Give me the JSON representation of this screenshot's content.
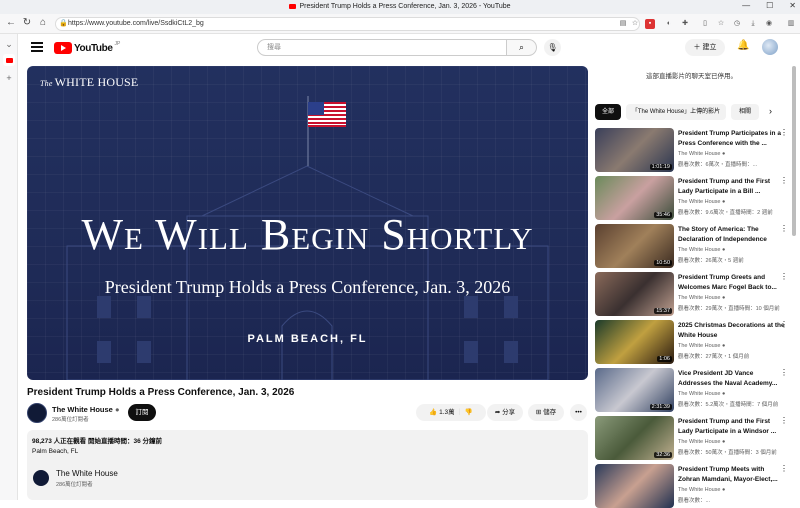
{
  "browser": {
    "tab_title": "President Trump Holds a Press Conference, Jan. 3, 2026 - YouTube",
    "url": "https://www.youtube.com/live/SsdkiCtL2_bg"
  },
  "youtube": {
    "logo_text": "YouTube",
    "logo_region": "JP",
    "search_placeholder": "搜尋",
    "create_label": "建立"
  },
  "player": {
    "logo_prefix": "The",
    "logo_text": "WHITE HOUSE",
    "headline": "We Will Begin Shortly",
    "subheadline": "President Trump Holds a Press Conference, Jan. 3, 2026",
    "location": "PALM BEACH, FL"
  },
  "video": {
    "title": "President Trump Holds a Press Conference, Jan. 3, 2026",
    "channel_name": "The White House",
    "channel_subs": "286萬位訂閱者",
    "subscribe_label": "訂閱",
    "likes": "1.3萬",
    "share_label": "分享",
    "save_label": "儲存",
    "more_label": "•••"
  },
  "description": {
    "line1": "98,273 人正在觀看  開始直播時間：36 分鐘前",
    "line2": "Palm Beach, FL",
    "channel_name": "The White House",
    "channel_subs": "286萬位訂閱者"
  },
  "chat": {
    "notice": "這部直播影片的聊天室已停用。"
  },
  "chips": [
    "全部",
    "「The White House」上傳的影片",
    "相關"
  ],
  "recommendations": [
    {
      "title": "President Trump Participates in a Press Conference with the ...",
      "channel": "The White House",
      "meta": "觀看次數：6萬次・直播時間：...",
      "duration": "1:01:19"
    },
    {
      "title": "President Trump and the First Lady Participate in a Bill ...",
      "channel": "The White House",
      "meta": "觀看次數：9.6萬次・直播時間：2 週前",
      "duration": "35:46"
    },
    {
      "title": "The Story of America: The Declaration of Independence",
      "channel": "The White House",
      "meta": "觀看次數：26萬次・5 週前",
      "duration": "10:50"
    },
    {
      "title": "President Trump Greets and Welcomes Marc Fogel Back to...",
      "channel": "The White House",
      "meta": "觀看次數：29萬次・直播時間：10 個月前",
      "duration": "15:37"
    },
    {
      "title": "2025 Christmas Decorations at the White House",
      "channel": "The White House",
      "meta": "觀看次數：27萬次・1 個月前",
      "duration": "1:06"
    },
    {
      "title": "Vice President JD Vance Addresses the Naval Academy...",
      "channel": "The White House",
      "meta": "觀看次數：5.2萬次・直播時間：7 個月前",
      "duration": "2:31:39"
    },
    {
      "title": "President Trump and the First Lady Participate in a Windsor ...",
      "channel": "The White House",
      "meta": "觀看次數：50萬次・直播時間：3 個月前",
      "duration": "32:36"
    },
    {
      "title": "President Trump Meets with Zohran Mamdani, Mayor-Elect,...",
      "channel": "The White House",
      "meta": "觀看次數：...",
      "duration": ""
    }
  ]
}
